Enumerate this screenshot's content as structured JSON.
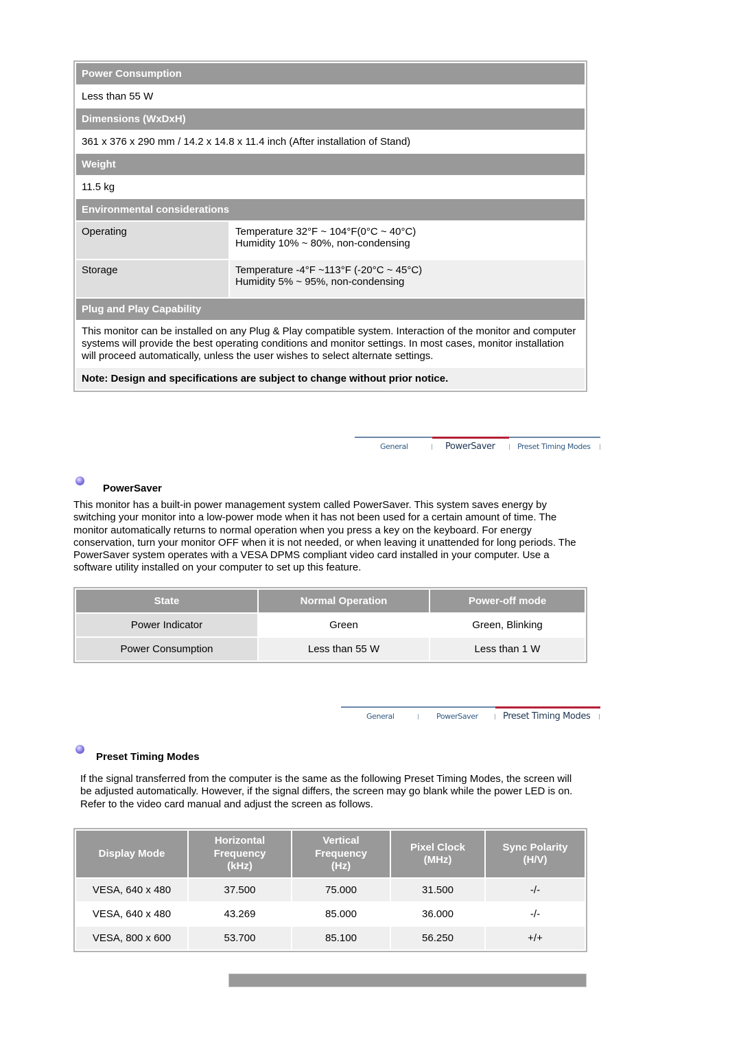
{
  "specs": {
    "power_consumption": {
      "title": "Power Consumption",
      "value": "Less than 55 W"
    },
    "dimensions": {
      "title": "Dimensions (WxDxH)",
      "value": "361 x 376 x 290 mm / 14.2 x 14.8 x 11.4 inch (After installation of Stand)"
    },
    "weight": {
      "title": "Weight",
      "value": "11.5 kg"
    },
    "environmental": {
      "title": "Environmental considerations",
      "rows": [
        {
          "label": "Operating",
          "line1": "Temperature 32°F ~ 104°F(0°C ~ 40°C)",
          "line2": "Humidity 10% ~ 80%, non-condensing"
        },
        {
          "label": "Storage",
          "line1": "Temperature -4°F ~113°F (-20°C ~ 45°C)",
          "line2": "Humidity 5% ~ 95%, non-condensing"
        }
      ]
    },
    "plug_and_play": {
      "title": "Plug and Play Capability",
      "text": "This monitor can be installed on any Plug & Play compatible system. Interaction of the monitor and computer systems will provide the best operating conditions and monitor settings. In most cases, monitor installation will proceed automatically, unless the user wishes to select alternate settings."
    },
    "note": "Note: Design and specifications are subject to change without prior notice."
  },
  "tabs": {
    "general": "General",
    "powersaver": "PowerSaver",
    "preset": "Preset Timing Modes",
    "accent_color": "#b51f35"
  },
  "powersaver": {
    "title": "PowerSaver",
    "text": "This monitor has a built-in power management system called PowerSaver. This system saves energy by switching your monitor into a low-power mode when it has not been used for a certain amount of time. The monitor automatically returns to normal operation when you press a key on the keyboard. For energy conservation, turn your monitor OFF when it is not needed, or when leaving it unattended for long periods. The PowerSaver system operates with a VESA DPMS compliant video card installed in your computer. Use a software utility installed on your computer to set up this feature.",
    "table": {
      "headers": [
        "State",
        "Normal Operation",
        "Power-off mode"
      ],
      "rows": [
        [
          "Power Indicator",
          "Green",
          "Green, Blinking"
        ],
        [
          "Power Consumption",
          "Less than 55 W",
          "Less than 1 W"
        ]
      ]
    }
  },
  "preset": {
    "title": "Preset Timing Modes",
    "text": "If the signal transferred from the computer is the same as the following Preset Timing Modes, the screen will be adjusted automatically. However, if the signal differs, the screen may go blank while the power LED is on. Refer to the video card manual and adjust the screen as follows.",
    "table": {
      "headers": [
        [
          "Display Mode"
        ],
        [
          "Horizontal",
          "Frequency",
          "(kHz)"
        ],
        [
          "Vertical",
          "Frequency",
          "(Hz)"
        ],
        [
          "Pixel Clock",
          "(MHz)"
        ],
        [
          "Sync Polarity",
          "(H/V)"
        ]
      ],
      "rows": [
        [
          "VESA, 640 x 480",
          "37.500",
          "75.000",
          "31.500",
          "-/-"
        ],
        [
          "VESA, 640 x 480",
          "43.269",
          "85.000",
          "36.000",
          "-/-"
        ],
        [
          "VESA, 800 x 600",
          "53.700",
          "85.100",
          "56.250",
          "+/+"
        ]
      ]
    }
  }
}
